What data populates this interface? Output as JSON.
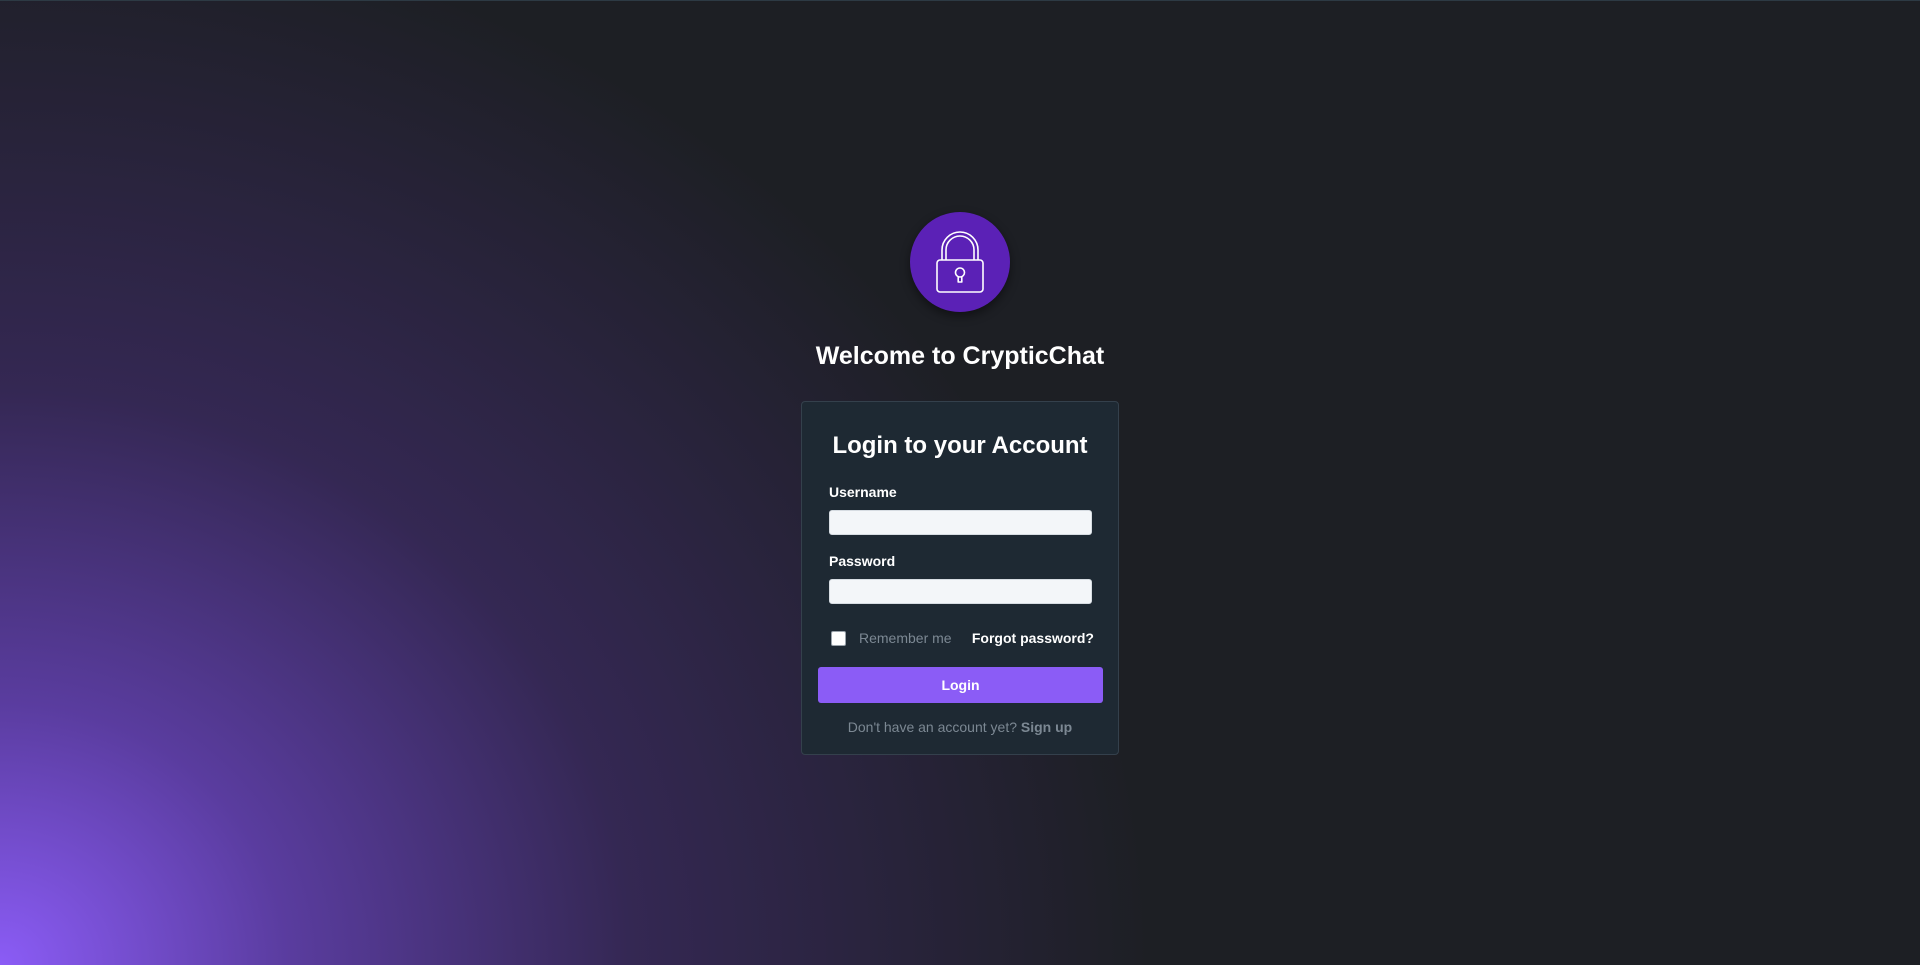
{
  "app": {
    "welcome_title": "Welcome to CrypticChat",
    "logo_icon": "lock-icon",
    "accent_color": "#8b5cf6",
    "logo_color": "#5b21b6"
  },
  "login_card": {
    "title": "Login to your Account",
    "username_label": "Username",
    "username_value": "",
    "password_label": "Password",
    "password_value": "",
    "remember_label": "Remember me",
    "remember_checked": false,
    "forgot_label": "Forgot password?",
    "login_label": "Login",
    "signup_prompt": "Don't have an account yet? ",
    "signup_label": "Sign up"
  }
}
